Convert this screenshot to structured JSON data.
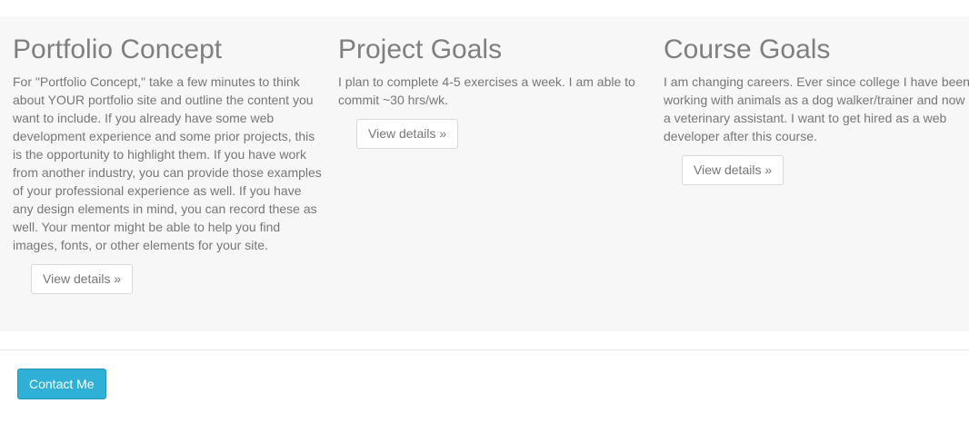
{
  "sections": [
    {
      "title": "Portfolio Concept",
      "body": "For \"Portfolio Concept,\" take a few minutes to think about YOUR portfolio site and outline the content you want to include. If you already have some web development experience and some prior projects, this is the opportunity to highlight them. If you have work from another industry, you can provide those examples of your professional experience as well. If you have any design elements in mind, you can record these as well. Your mentor might be able to help you find images, fonts, or other elements for your site.",
      "button_label": "View details »"
    },
    {
      "title": "Project Goals",
      "body": "I plan to complete 4-5 exercises a week. I am able to commit ~30 hrs/wk.",
      "button_label": "View details »"
    },
    {
      "title": "Course Goals",
      "body": "I am changing careers. Ever since college I have been working with animals as a dog walker/trainer and now a veterinary assistant. I want to get hired as a web developer after this course.",
      "button_label": "View details »"
    }
  ],
  "footer": {
    "contact_label": "Contact Me"
  },
  "colors": {
    "panel_background": "#f7f7f7",
    "heading_text": "#7f7f7f",
    "body_text": "#777777",
    "contact_button": "#2fb0d6"
  }
}
